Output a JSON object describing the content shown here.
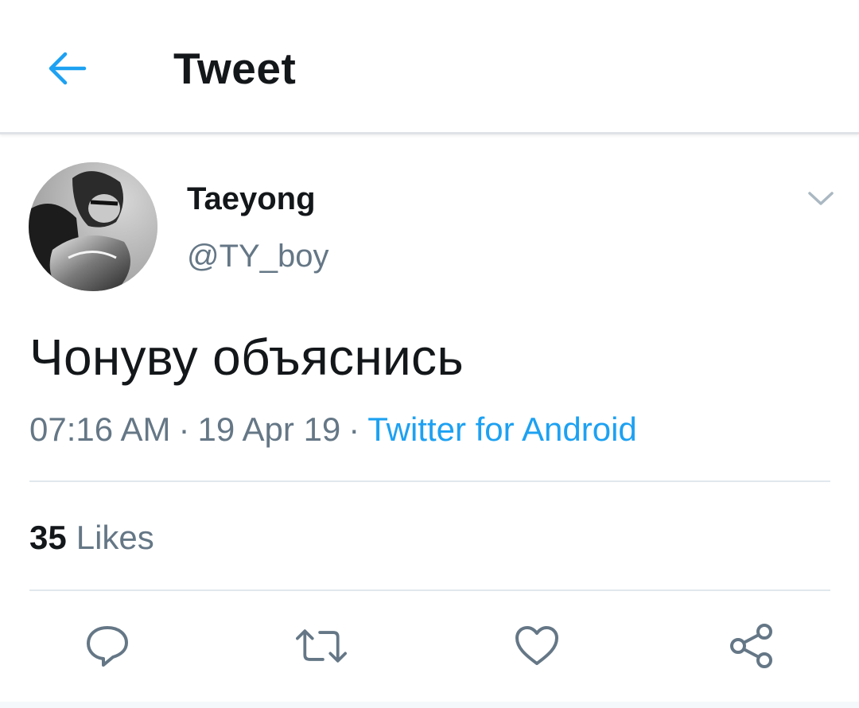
{
  "header": {
    "title": "Tweet",
    "back_icon": "arrow-left-icon"
  },
  "tweet": {
    "author": {
      "display_name": "Taeyong",
      "handle": "@TY_boy",
      "avatar": "profile-photo"
    },
    "text": "Чонуву объяснись",
    "time": "07:16 AM",
    "date": "19 Apr 19",
    "separator": "·",
    "source": "Twitter for Android",
    "likes_count": "35",
    "likes_label": "Likes"
  },
  "actions": {
    "reply_icon": "reply-icon",
    "retweet_icon": "retweet-icon",
    "like_icon": "heart-icon",
    "share_icon": "share-icon"
  },
  "colors": {
    "accent": "#1da1f2",
    "text": "#14171a",
    "secondary": "#657786",
    "divider": "#e1e8ed"
  }
}
